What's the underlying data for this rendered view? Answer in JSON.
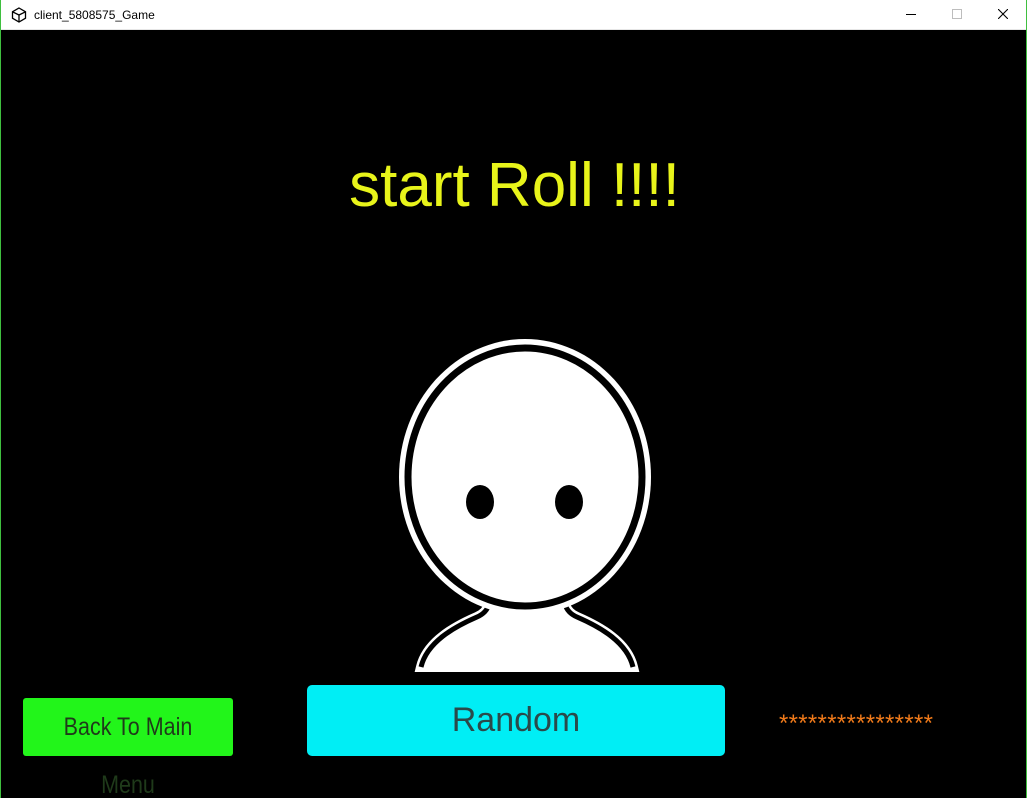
{
  "window": {
    "title": "client_5808575_Game",
    "icons": {
      "app": "unity-logo-icon",
      "minimize": "minimize-icon",
      "maximize": "maximize-icon",
      "close": "close-icon"
    }
  },
  "game": {
    "headline": "start Roll !!!!",
    "character": "round-head-character",
    "buttons": {
      "back": "Back To Main Menu",
      "random": "Random"
    },
    "masked_text": "****************",
    "colors": {
      "background": "#000000",
      "headline": "#e8f41a",
      "back_button": "#22f51a",
      "random_button": "#00eef5",
      "masked_text": "#f07a1a"
    }
  }
}
